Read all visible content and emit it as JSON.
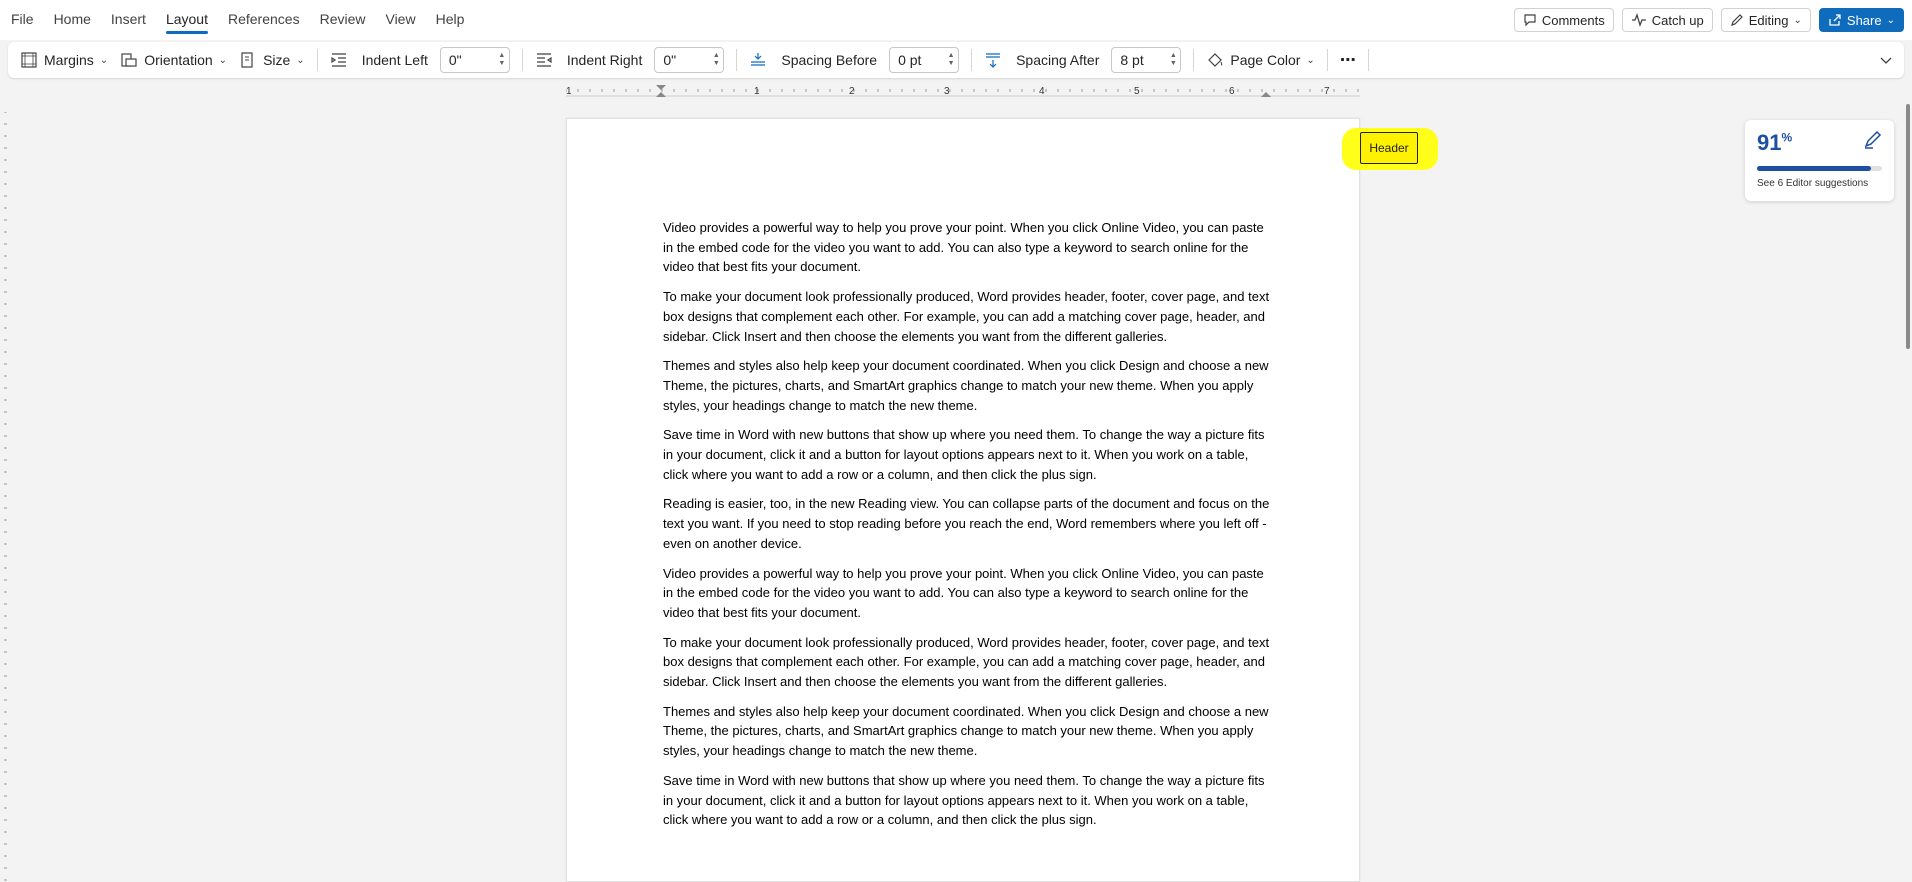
{
  "menu": {
    "tabs": [
      "File",
      "Home",
      "Insert",
      "Layout",
      "References",
      "Review",
      "View",
      "Help"
    ],
    "active_tab": "Layout"
  },
  "top_right": {
    "comments_label": "Comments",
    "catchup_label": "Catch up",
    "editing_label": "Editing",
    "share_label": "Share"
  },
  "ribbon": {
    "margins_label": "Margins",
    "orientation_label": "Orientation",
    "size_label": "Size",
    "indent_left_label": "Indent Left",
    "indent_left_value": "0\"",
    "indent_right_label": "Indent Right",
    "indent_right_value": "0\"",
    "spacing_before_label": "Spacing Before",
    "spacing_before_value": "0 pt",
    "spacing_after_label": "Spacing After",
    "spacing_after_value": "8 pt",
    "page_color_label": "Page Color",
    "more_label": "⋯"
  },
  "ruler": {
    "numbers": [
      "1",
      "1",
      "2",
      "3",
      "4",
      "5",
      "6",
      "7"
    ]
  },
  "document": {
    "header_label": "Header",
    "paragraphs": [
      "Video provides a powerful way to help you prove your point. When you click Online Video, you can paste in the embed code for the video you want to add. You can also type a keyword to search online for the video that best fits your document.",
      "To make your document look professionally produced, Word provides header, footer, cover page, and text box designs that complement each other. For example, you can add a matching cover page, header, and sidebar. Click Insert and then choose the elements you want from the different galleries.",
      "Themes and styles also help keep your document coordinated. When you click Design and choose a new Theme, the pictures, charts, and SmartArt graphics change to match your new theme. When you apply styles, your headings change to match the new theme.",
      "Save time in Word with new buttons that show up where you need them. To change the way a picture fits in your document, click it and a button for layout options appears next to it. When you work on a table, click where you want to add a row or a column, and then click the plus sign.",
      "Reading is easier, too, in the new Reading view. You can collapse parts of the document and focus on the text you want. If you need to stop reading before you reach the end, Word remembers where you left off - even on another device.",
      "Video provides a powerful way to help you prove your point. When you click Online Video, you can paste in the embed code for the video you want to add. You can also type a keyword to search online for the video that best fits your document.",
      "To make your document look professionally produced, Word provides header, footer, cover page, and text box designs that complement each other. For example, you can add a matching cover page, header, and sidebar. Click Insert and then choose the elements you want from the different galleries.",
      "Themes and styles also help keep your document coordinated. When you click Design and choose a new Theme, the pictures, charts, and SmartArt graphics change to match your new theme. When you apply styles, your headings change to match the new theme.",
      "Save time in Word with new buttons that show up where you need them. To change the way a picture fits in your document, click it and a button for layout options appears next to it. When you work on a table, click where you want to add a row or a column, and then click the plus sign."
    ]
  },
  "editor": {
    "score": "91",
    "score_suffix": "%",
    "progress": 0.91,
    "suggestions_label": "See 6 Editor suggestions"
  },
  "colors": {
    "accent": "#0f6cbd",
    "highlight": "#ffff1a",
    "editor_blue": "#1e4fa3"
  }
}
